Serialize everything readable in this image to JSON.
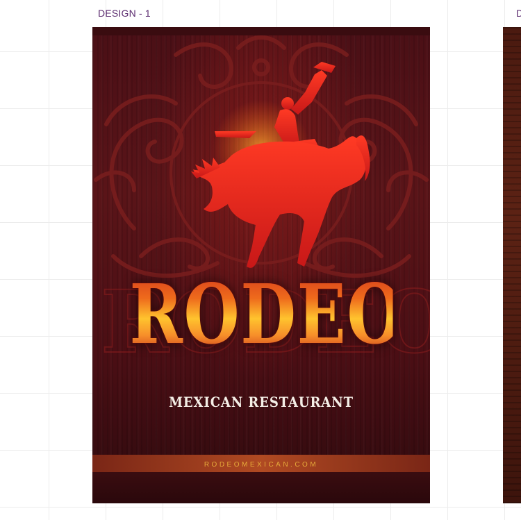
{
  "designs": [
    {
      "label": "DESIGN - 1",
      "poster": {
        "title": "RODEO",
        "subtitle": "MEXICAN RESTAURANT",
        "website": "RODEOMEXICAN.COM"
      }
    },
    {
      "label": "D"
    }
  ],
  "colors": {
    "background": "#ffffff",
    "label": "#5a2a6e",
    "poster_bg": "#4a0f16",
    "title_gradient": [
      "#d8401c",
      "#ffc32e",
      "#c8321a"
    ],
    "rider": "#d8261c",
    "band": "#b04a22",
    "website_text": "#e6aa3a"
  },
  "icons": {
    "rider": "bucking-horse-cowboy-silhouette",
    "ornament": "western-scroll-ornament"
  }
}
